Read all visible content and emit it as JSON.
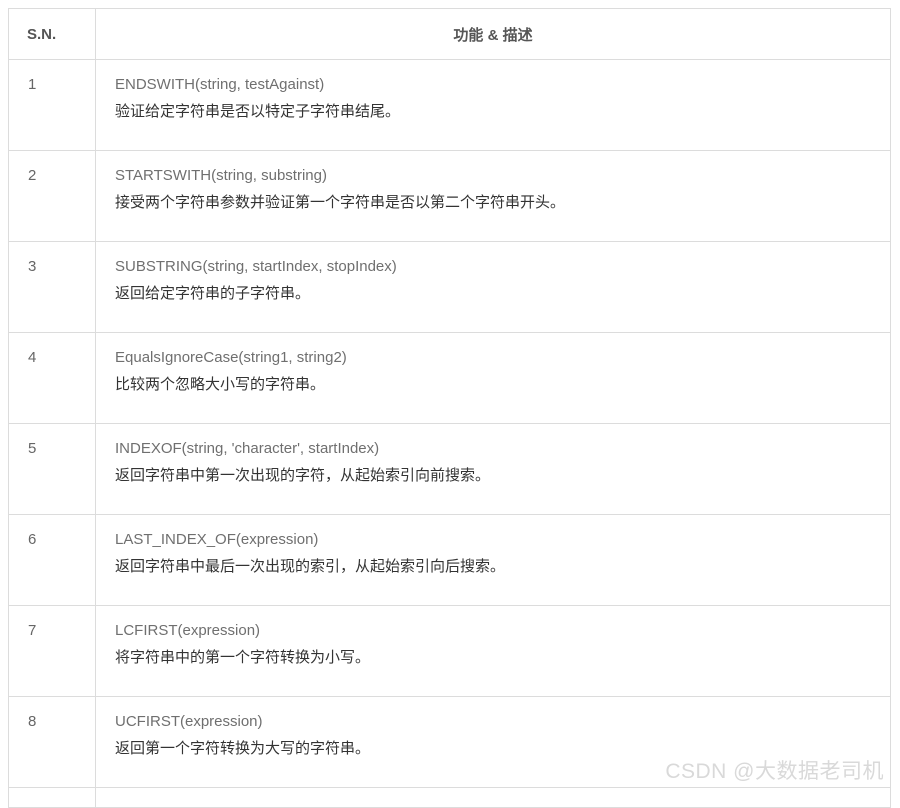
{
  "table": {
    "headers": {
      "sn": "S.N.",
      "description": "功能 & 描述"
    },
    "rows": [
      {
        "sn": "1",
        "function": "ENDSWITH(string, testAgainst)",
        "description": "验证给定字符串是否以特定子字符串结尾。"
      },
      {
        "sn": "2",
        "function": "STARTSWITH(string, substring)",
        "description": "接受两个字符串参数并验证第一个字符串是否以第二个字符串开头。"
      },
      {
        "sn": "3",
        "function": "SUBSTRING(string, startIndex, stopIndex)",
        "description": "返回给定字符串的子字符串。"
      },
      {
        "sn": "4",
        "function": "EqualsIgnoreCase(string1, string2)",
        "description": "比较两个忽略大小写的字符串。"
      },
      {
        "sn": "5",
        "function": "INDEXOF(string, 'character', startIndex)",
        "description": "返回字符串中第一次出现的字符，从起始索引向前搜索。"
      },
      {
        "sn": "6",
        "function": "LAST_INDEX_OF(expression)",
        "description": "返回字符串中最后一次出现的索引，从起始索引向后搜索。"
      },
      {
        "sn": "7",
        "function": "LCFIRST(expression)",
        "description": "将字符串中的第一个字符转换为小写。"
      },
      {
        "sn": "8",
        "function": "UCFIRST(expression)",
        "description": "返回第一个字符转换为大写的字符串。"
      }
    ]
  },
  "watermark": "CSDN @大数据老司机"
}
